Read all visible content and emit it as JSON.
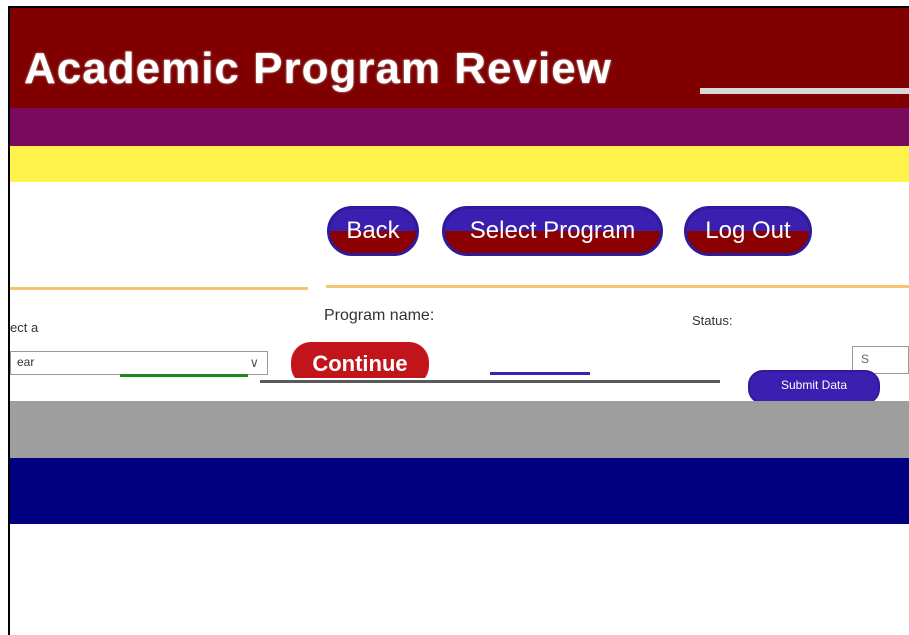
{
  "header": {
    "title": "Academic Program Review"
  },
  "nav": {
    "back_label": "Back",
    "select_program_label": "Select Program",
    "logout_label": "Log Out"
  },
  "form": {
    "left_label": "ect a",
    "select_value": "ear",
    "program_label": "Program name:",
    "status_label": "Status:",
    "continue_label": "Continue",
    "right_field_value": "S",
    "action_label": "Submit Data"
  },
  "colors": {
    "maroon": "#800000",
    "purple": "#7a0a5e",
    "yellow": "#fff24a",
    "accent_rule": "#f6c46e",
    "button_blue": "#3a1fb0",
    "continue_red": "#c2151b",
    "gray_band": "#9e9e9e",
    "navy_band": "#000080"
  },
  "icons": {
    "select_chevron": "chevron-down-icon"
  }
}
